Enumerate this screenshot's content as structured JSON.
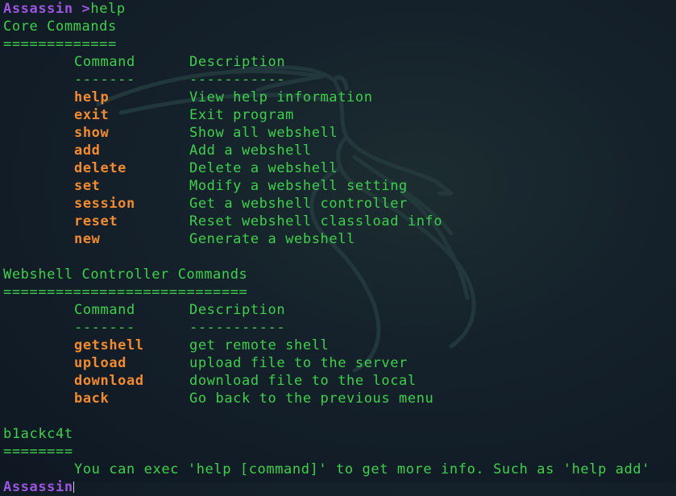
{
  "prompt": {
    "user": "Assassin",
    "symbol": " >",
    "command": "help"
  },
  "core": {
    "title": "Core Commands",
    "underline": "=============",
    "header": {
      "command": "Command",
      "description": "Description"
    },
    "header_rule": {
      "command": "-------",
      "description": "-----------"
    },
    "rows": [
      {
        "command": "help",
        "description": "View help information"
      },
      {
        "command": "exit",
        "description": "Exit program"
      },
      {
        "command": "show",
        "description": "Show all webshell"
      },
      {
        "command": "add",
        "description": "Add a webshell"
      },
      {
        "command": "delete",
        "description": "Delete a webshell"
      },
      {
        "command": "set",
        "description": "Modify a webshell setting"
      },
      {
        "command": "session",
        "description": "Get a webshell controller"
      },
      {
        "command": "reset",
        "description": "Reset webshell classload info"
      },
      {
        "command": "new",
        "description": "Generate a webshell"
      }
    ]
  },
  "controller": {
    "title": "Webshell Controller Commands",
    "underline": "============================",
    "header": {
      "command": "Command",
      "description": "Description"
    },
    "header_rule": {
      "command": "-------",
      "description": "-----------"
    },
    "rows": [
      {
        "command": "getshell",
        "description": "get remote shell"
      },
      {
        "command": "upload",
        "description": "upload file to the server"
      },
      {
        "command": "download",
        "description": "download file to the local"
      },
      {
        "command": "back",
        "description": "Go back to the previous menu"
      }
    ]
  },
  "author": {
    "title": "b1ackc4t",
    "underline": "========",
    "note": "You can exec 'help [command]' to get more info. Such as 'help add'"
  },
  "next_prompt": {
    "user": "Assassin"
  },
  "colors": {
    "text": "#3cd14a",
    "command": "#f28a2e",
    "prompt": "#9b55e0",
    "background": "#14202a"
  },
  "background_icon": "kali-dragon-icon"
}
